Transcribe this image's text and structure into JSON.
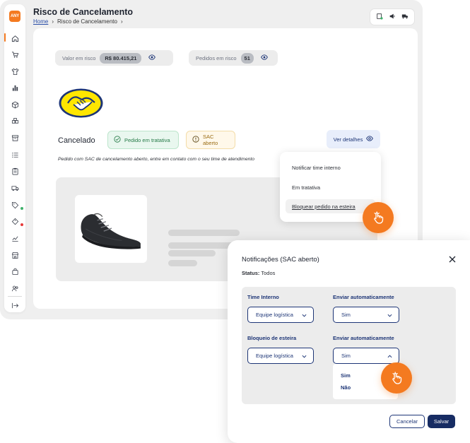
{
  "app": {
    "logo_text": "ANY",
    "accent": "#f47a20",
    "brand": "#1d3576"
  },
  "header": {
    "title": "Risco de Cancelamento",
    "breadcrumb": {
      "home": "Home",
      "current": "Risco de Cancelamento"
    },
    "actions": [
      "store-check-icon",
      "megaphone-icon",
      "truck-icon"
    ]
  },
  "sidebar": {
    "items": [
      "home-icon",
      "cart-icon",
      "shirt-icon",
      "bar-chart-icon",
      "box-icon",
      "boxes-icon",
      "archive-icon",
      "list-icon",
      "clipboard-icon",
      "truck-icon",
      "tag-icon",
      "tag-alert-icon",
      "line-chart-icon",
      "store-icon",
      "bag-icon",
      "users-icon"
    ],
    "expand": "collapse-arrow-icon"
  },
  "stats": {
    "value_label": "Valor em risco",
    "value": "R$ 80.415,21",
    "orders_label": "Pedidos em risco",
    "orders": "51"
  },
  "order": {
    "status": "Cancelado",
    "badge_treatment": "Pedido em tratativa",
    "badge_sac": "SAC aberto",
    "details_button": "Ver detalhes",
    "info": "Pedido com SAC de cancelamento aberto, entre em contato com o seu time de atendimento"
  },
  "action_menu": {
    "items": [
      "Notificar time interno",
      "Em tratativa",
      "Bloquear pedido na esteira"
    ],
    "selected": 2
  },
  "modal": {
    "title": "Notificações (SAC aberto)",
    "status_label": "Status:",
    "status_value": "Todos",
    "rules": [
      {
        "label": "Time Interno",
        "team": "Equipe logística",
        "auto_label": "Enviar automaticamente",
        "auto_value": "Sim"
      },
      {
        "label": "Bloqueio de esteira",
        "team": "Equipe logística",
        "auto_label": "Enviar automaticamente",
        "auto_value": "Sim"
      }
    ],
    "options": [
      "Sim",
      "Não"
    ],
    "cancel": "Cancelar",
    "save": "Salvar"
  }
}
